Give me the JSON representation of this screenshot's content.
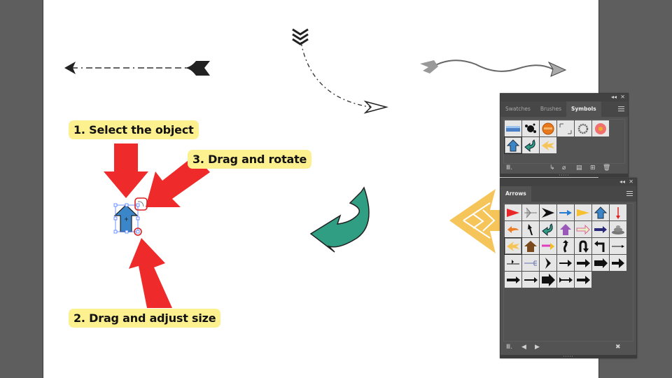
{
  "callouts": {
    "step1": "1. Select the object",
    "step2": "2. Drag and adjust size",
    "step3": "3. Drag and rotate"
  },
  "colors": {
    "canvas_bg": "#5e5e5e",
    "artboard": "#ffffff",
    "callout_bg": "#fdf08f",
    "pointer_red": "#ee2a2a",
    "selection_blue": "#4a7cff",
    "handle_highlight": "#dd2222",
    "teal_arrow": "#2f9e82",
    "gold_arrow": "#f6c55a",
    "blue_arrow": "#3a86c8"
  },
  "symbols_panel": {
    "tabs": [
      {
        "label": "Swatches",
        "active": false
      },
      {
        "label": "Brushes",
        "active": false
      },
      {
        "label": "Symbols",
        "active": true
      }
    ],
    "collapse_icon": "double-chevron-icon",
    "close_icon": "close-icon",
    "menu_icon": "hamburger-icon",
    "symbols": [
      {
        "name": "blue-gradient-bar"
      },
      {
        "name": "ink-splatter"
      },
      {
        "name": "orange-button"
      },
      {
        "name": "corner-frame"
      },
      {
        "name": "gray-ring"
      },
      {
        "name": "pink-flower"
      },
      {
        "name": "blue-up-arrow",
        "selected": true
      },
      {
        "name": "green-curved-arrow"
      },
      {
        "name": "yellow-left-arrow"
      }
    ],
    "footer_icons": [
      "symbol-library-icon",
      "place-symbol-icon",
      "break-link-icon",
      "symbol-options-icon",
      "new-symbol-icon",
      "delete-icon"
    ]
  },
  "arrows_panel": {
    "title": "Arrows",
    "collapse_icon": "double-chevron-icon",
    "close_icon": "close-icon",
    "menu_icon": "hamburger-icon",
    "symbols": [
      {
        "name": "red-flag-arrow"
      },
      {
        "name": "gray-feather-arrow"
      },
      {
        "name": "black-chevron-arrow"
      },
      {
        "name": "blue-thin-arrow"
      },
      {
        "name": "yellow-pennant-arrow"
      },
      {
        "name": "blue-up-arrow"
      },
      {
        "name": "red-down-arrow"
      },
      {
        "name": "orange-curved-left-arrow"
      },
      {
        "name": "black-cursor-arrow"
      },
      {
        "name": "green-curved-arrow"
      },
      {
        "name": "purple-up-arrow"
      },
      {
        "name": "pink-outline-arrow"
      },
      {
        "name": "navy-arrow"
      },
      {
        "name": "stacked-stone-arrow"
      },
      {
        "name": "yellow-left-arrow",
        "selected": true
      },
      {
        "name": "brown-house-arrow"
      },
      {
        "name": "rainbow-arrow"
      },
      {
        "name": "wavy-up-arrow"
      },
      {
        "name": "u-turn-arrow"
      },
      {
        "name": "left-turn-arrow"
      },
      {
        "name": "thin-line-arrow"
      },
      {
        "name": "weathervane-arrow"
      },
      {
        "name": "trident-arrow"
      },
      {
        "name": "black-chevron-right"
      },
      {
        "name": "black-arrow-1"
      },
      {
        "name": "black-arrow-2"
      },
      {
        "name": "black-block-arrow"
      },
      {
        "name": "black-bold-arrow"
      },
      {
        "name": "black-arrow-3"
      },
      {
        "name": "black-arrow-4"
      },
      {
        "name": "black-big-arrow"
      },
      {
        "name": "black-feather-arrow"
      },
      {
        "name": "black-arrow-5"
      }
    ],
    "footer_icons": [
      "symbol-library-icon",
      "previous-library-icon",
      "next-library-icon",
      "close-library-icon"
    ]
  }
}
